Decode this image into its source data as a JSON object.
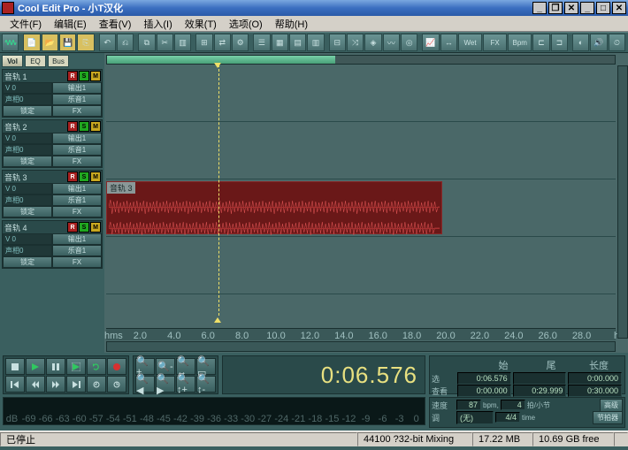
{
  "title": "Cool Edit Pro  - 小T汉化",
  "menu": [
    "文件(F)",
    "编辑(E)",
    "查看(V)",
    "插入(I)",
    "效果(T)",
    "选项(O)",
    "帮助(H)"
  ],
  "tabs": [
    "Vol",
    "EQ",
    "Bus"
  ],
  "tracks": [
    {
      "name": "音轨 1",
      "v": "V 0",
      "out": "输出1",
      "pan": "声相0",
      "eq": "乐音1",
      "lock": "锁定",
      "fx": "FX"
    },
    {
      "name": "音轨 2",
      "v": "V 0",
      "out": "输出1",
      "pan": "声相0",
      "eq": "乐音1",
      "lock": "锁定",
      "fx": "FX"
    },
    {
      "name": "音轨 3",
      "v": "V 0",
      "out": "输出1",
      "pan": "声相0",
      "eq": "乐音1",
      "lock": "锁定",
      "fx": "FX"
    },
    {
      "name": "音轨 4",
      "v": "V 0",
      "out": "输出1",
      "pan": "声相0",
      "eq": "乐音1",
      "lock": "锁定",
      "fx": "FX"
    }
  ],
  "clip_label": "音轨 3",
  "ruler": [
    "hms",
    "2.0",
    "4.0",
    "6.0",
    "8.0",
    "10.0",
    "12.0",
    "14.0",
    "16.0",
    "18.0",
    "20.0",
    "22.0",
    "24.0",
    "26.0",
    "28.0",
    "hms"
  ],
  "timecode": "0:06.576",
  "sel": {
    "head": [
      "始",
      "尾",
      "长度"
    ],
    "row1_lbl": "选",
    "row2_lbl": "查看",
    "r1": [
      "0:06.576",
      "",
      "0:00.000"
    ],
    "r2": [
      "0:00.000",
      "0:29.999",
      "0:30.000"
    ]
  },
  "tempo": {
    "speed_lbl": "速度",
    "bpm": "87",
    "bpm_unit": "bpm,",
    "beats": "4",
    "beats_unit": "拍/小节",
    "adv": "高级",
    "key_lbl": "调",
    "key": "(无)",
    "sig": "4/4",
    "time_lbl": "time",
    "metro": "节拍器"
  },
  "meter_scale": [
    "dB",
    "-69",
    "-66",
    "-63",
    "-60",
    "-57",
    "-54",
    "-51",
    "-48",
    "-45",
    "-42",
    "-39",
    "-36",
    "-33",
    "-30",
    "-27",
    "-24",
    "-21",
    "-18",
    "-15",
    "-12",
    "-9",
    "-6",
    "-3",
    "0"
  ],
  "status": {
    "state": "已停止",
    "fmt": "44100 ?32-bit Mixing",
    "mem": "17.22 MB",
    "disk": "10.69 GB free"
  }
}
